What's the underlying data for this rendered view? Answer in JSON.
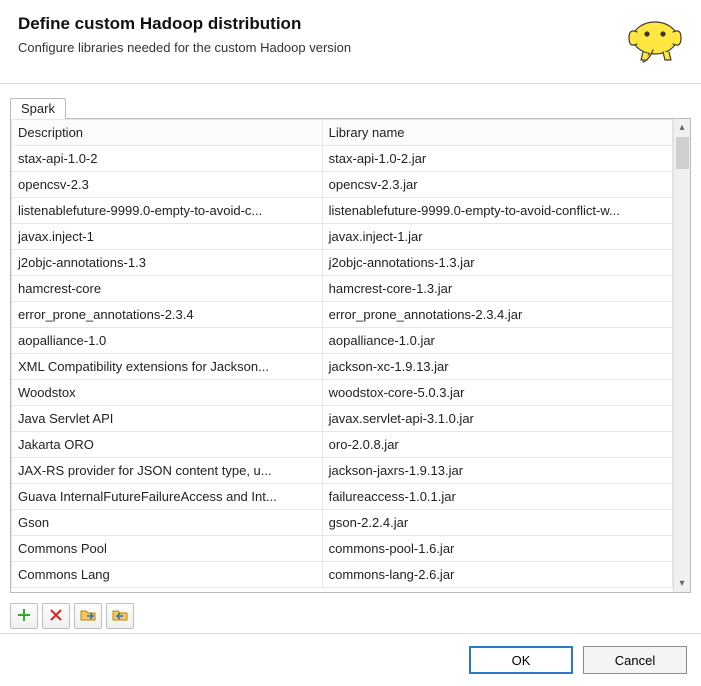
{
  "header": {
    "title": "Define custom Hadoop distribution",
    "subtitle": "Configure libraries needed for the custom Hadoop version"
  },
  "tabs": [
    {
      "label": "Spark"
    }
  ],
  "table": {
    "columns": {
      "description": "Description",
      "library": "Library name"
    },
    "rows": [
      {
        "description": "stax-api-1.0-2",
        "library": "stax-api-1.0-2.jar"
      },
      {
        "description": "opencsv-2.3",
        "library": "opencsv-2.3.jar"
      },
      {
        "description": "listenablefuture-9999.0-empty-to-avoid-c...",
        "library": "listenablefuture-9999.0-empty-to-avoid-conflict-w..."
      },
      {
        "description": "javax.inject-1",
        "library": "javax.inject-1.jar"
      },
      {
        "description": "j2objc-annotations-1.3",
        "library": "j2objc-annotations-1.3.jar"
      },
      {
        "description": "hamcrest-core",
        "library": "hamcrest-core-1.3.jar"
      },
      {
        "description": "error_prone_annotations-2.3.4",
        "library": "error_prone_annotations-2.3.4.jar"
      },
      {
        "description": "aopalliance-1.0",
        "library": "aopalliance-1.0.jar"
      },
      {
        "description": "XML Compatibility extensions for Jackson...",
        "library": "jackson-xc-1.9.13.jar"
      },
      {
        "description": "Woodstox",
        "library": "woodstox-core-5.0.3.jar"
      },
      {
        "description": "Java Servlet API",
        "library": "javax.servlet-api-3.1.0.jar"
      },
      {
        "description": "Jakarta ORO",
        "library": "oro-2.0.8.jar"
      },
      {
        "description": "JAX-RS provider for JSON content type, u...",
        "library": "jackson-jaxrs-1.9.13.jar"
      },
      {
        "description": "Guava InternalFutureFailureAccess and Int...",
        "library": "failureaccess-1.0.1.jar"
      },
      {
        "description": "Gson",
        "library": "gson-2.2.4.jar"
      },
      {
        "description": "Commons Pool",
        "library": "commons-pool-1.6.jar"
      },
      {
        "description": "Commons Lang",
        "library": "commons-lang-2.6.jar"
      }
    ]
  },
  "toolbar": {
    "add": "add",
    "remove": "remove",
    "import": "import",
    "export": "export"
  },
  "footer": {
    "ok": "OK",
    "cancel": "Cancel"
  }
}
